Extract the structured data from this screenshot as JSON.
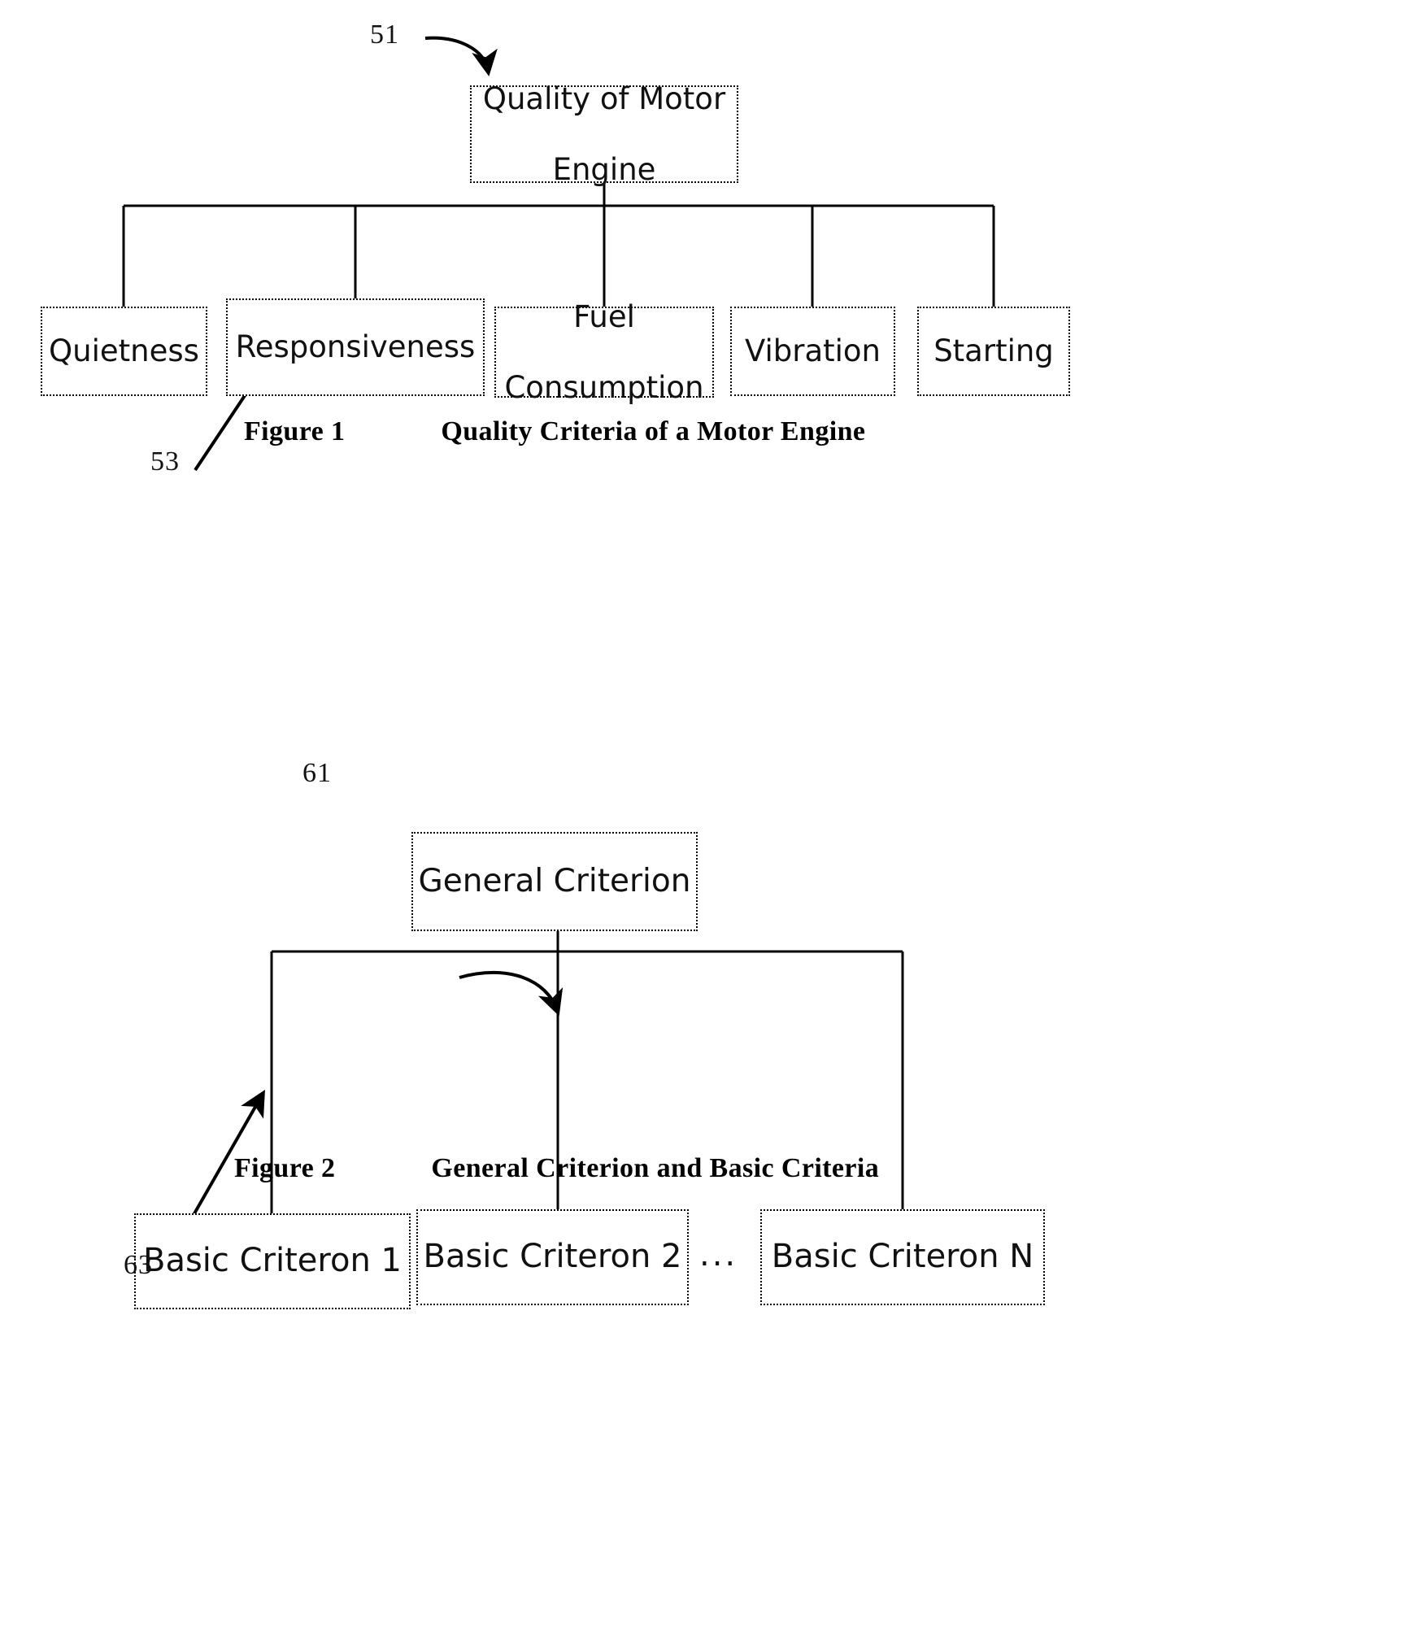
{
  "figures": [
    {
      "id": "figure-1",
      "ref_root": "51",
      "ref_caption": "53",
      "root": {
        "text": "Quality of Motor Engine",
        "line1": "Quality of Motor",
        "line2": "Engine"
      },
      "children": [
        {
          "label": "Quietness"
        },
        {
          "label": "Responsiveness"
        },
        {
          "label": "Fuel Consumption",
          "line1": "Fuel",
          "line2": "Consumption"
        },
        {
          "label": "Vibration"
        },
        {
          "label": "Starting"
        }
      ],
      "caption": {
        "label": "Figure 1",
        "title": "Quality Criteria of a Motor Engine"
      }
    },
    {
      "id": "figure-2",
      "ref_root": "61",
      "ref_caption": "63",
      "root": {
        "text": "General Criterion"
      },
      "children": [
        {
          "label": "Basic Criteron 1"
        },
        {
          "label": "Basic Criteron 2"
        },
        {
          "label": "Basic Criteron N"
        }
      ],
      "ellipsis": "...",
      "caption": {
        "label": "Figure 2",
        "title": "General Criterion and Basic Criteria"
      }
    }
  ],
  "colors": {
    "ink": "#000000",
    "background": "#ffffff"
  }
}
